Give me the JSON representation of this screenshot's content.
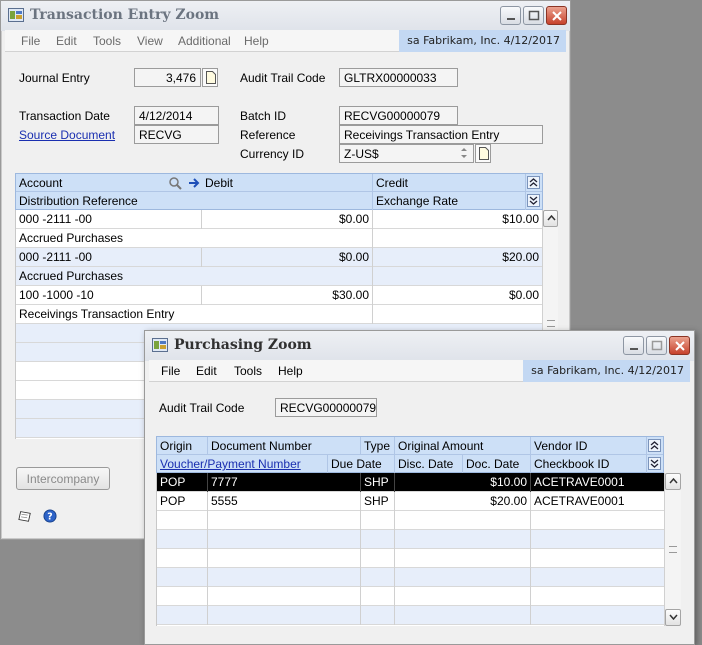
{
  "transaction_window": {
    "title": "Transaction Entry Zoom",
    "menu": [
      "File",
      "Edit",
      "Tools",
      "View",
      "Additional",
      "Help"
    ],
    "user_info": "sa  Fabrikam, Inc.  4/12/2017",
    "journal_entry": {
      "label": "Journal Entry",
      "value": "3,476"
    },
    "audit_trail_code": {
      "label": "Audit Trail Code",
      "value": "GLTRX00000033"
    },
    "transaction_date": {
      "label": "Transaction Date",
      "value": "4/12/2014"
    },
    "batch_id": {
      "label": "Batch ID",
      "value": "RECVG00000079"
    },
    "source_document": {
      "label": "Source Document",
      "value": "RECVG"
    },
    "reference": {
      "label": "Reference",
      "value": "Receivings Transaction Entry"
    },
    "currency_id": {
      "label": "Currency ID",
      "value": "Z-US$"
    },
    "grid": {
      "header1": {
        "account": "Account",
        "debit": "Debit",
        "credit": "Credit"
      },
      "header2": {
        "distribution_reference": "Distribution Reference",
        "exchange_rate": "Exchange Rate"
      },
      "rows": [
        {
          "account": "000 -2111 -00",
          "debit": "$0.00",
          "credit": "$10.00",
          "description": "Accrued Purchases"
        },
        {
          "account": "000 -2111 -00",
          "debit": "$0.00",
          "credit": "$20.00",
          "description": "Accrued Purchases"
        },
        {
          "account": "100 -1000 -10",
          "debit": "$30.00",
          "credit": "$0.00",
          "description": "Receivings Transaction Entry"
        }
      ]
    },
    "intercompany_button": "Intercompany"
  },
  "purchasing_window": {
    "title": "Purchasing Zoom",
    "menu": [
      "File",
      "Edit",
      "Tools",
      "Help"
    ],
    "user_info": "sa  Fabrikam, Inc.  4/12/2017",
    "audit_trail_code": {
      "label": "Audit Trail Code",
      "value": "RECVG00000079"
    },
    "grid": {
      "header1": {
        "origin": "Origin",
        "document_number": "Document Number",
        "type": "Type",
        "original_amount": "Original Amount",
        "vendor_id": "Vendor ID"
      },
      "header2": {
        "voucher_payment_number": "Voucher/Payment Number",
        "due_date": "Due Date",
        "disc_date": "Disc. Date",
        "doc_date": "Doc. Date",
        "checkbook_id": "Checkbook ID"
      },
      "rows": [
        {
          "origin": "POP",
          "document_number": "7777",
          "type": "SHP",
          "amount": "$10.00",
          "vendor_id": "ACETRAVE0001",
          "selected": true
        },
        {
          "origin": "POP",
          "document_number": "5555",
          "type": "SHP",
          "amount": "$20.00",
          "vendor_id": "ACETRAVE0001",
          "selected": false
        }
      ]
    }
  },
  "colors": {
    "grid_header": "#cde0f7",
    "user_bar": "#c3d8f3",
    "link": "#1a2fb0",
    "close_button": "#c7412b"
  }
}
